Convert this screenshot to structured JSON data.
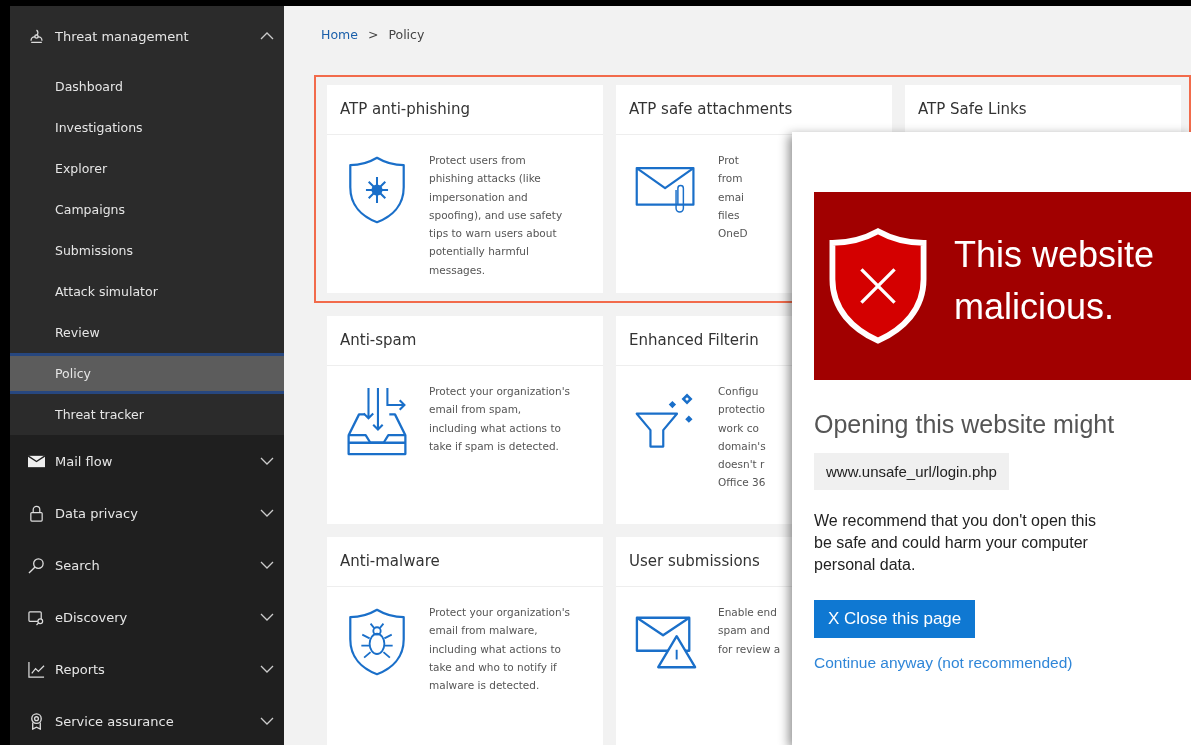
{
  "sidebar": {
    "groups": [
      {
        "label": "Threat management",
        "expanded": true,
        "children": [
          {
            "label": "Dashboard",
            "selected": false
          },
          {
            "label": "Investigations",
            "selected": false
          },
          {
            "label": "Explorer",
            "selected": false
          },
          {
            "label": "Campaigns",
            "selected": false
          },
          {
            "label": "Submissions",
            "selected": false
          },
          {
            "label": "Attack simulator",
            "selected": false
          },
          {
            "label": "Review",
            "selected": false
          },
          {
            "label": "Policy",
            "selected": true
          },
          {
            "label": "Threat tracker",
            "selected": false
          }
        ]
      },
      {
        "label": "Mail flow",
        "expanded": false
      },
      {
        "label": "Data privacy",
        "expanded": false
      },
      {
        "label": "Search",
        "expanded": false
      },
      {
        "label": "eDiscovery",
        "expanded": false
      },
      {
        "label": "Reports",
        "expanded": false
      },
      {
        "label": "Service assurance",
        "expanded": false
      }
    ]
  },
  "breadcrumb": {
    "items": [
      "Home",
      "Policy"
    ],
    "separator": ">"
  },
  "card_rows": [
    {
      "highlighted": true,
      "cards": [
        {
          "title": "ATP anti-phishing",
          "description": "Protect users from\nphishing attacks (like\nimpersonation and\nspoofing), and use safety\ntips to warn users about\npotentially harmful\nmessages."
        },
        {
          "title": "ATP safe attachments",
          "description": "Prot\nfrom\nemai\nfiles\nOneD"
        },
        {
          "title": "ATP Safe Links"
        }
      ]
    },
    {
      "highlighted": false,
      "cards": [
        {
          "title": "Anti-spam",
          "description": "Protect your organization's\nemail from spam,\nincluding what actions to\ntake if spam is detected."
        },
        {
          "title": "Enhanced Filterin",
          "description": "Configu\nprotectio\nwork co\ndomain's\ndoesn't r\nOffice 36"
        }
      ]
    },
    {
      "highlighted": false,
      "cards": [
        {
          "title": "Anti-malware",
          "description": "Protect your organization's\nemail from malware,\nincluding what actions to\ntake and who to notify if\nmalware is detected."
        },
        {
          "title": "User submissions",
          "description": "Enable end\nspam and\nfor review a"
        }
      ]
    }
  ],
  "warning_dialog": {
    "heading": "This website\nmalicious.",
    "subheading": "Opening this website might",
    "url": "www.unsafe_url/login.php",
    "message": "We recommend that you don't open this\nbe safe and could harm your computer\npersonal data.",
    "close_button": "X Close this page",
    "continue_link": "Continue anyway (not recommended)"
  }
}
